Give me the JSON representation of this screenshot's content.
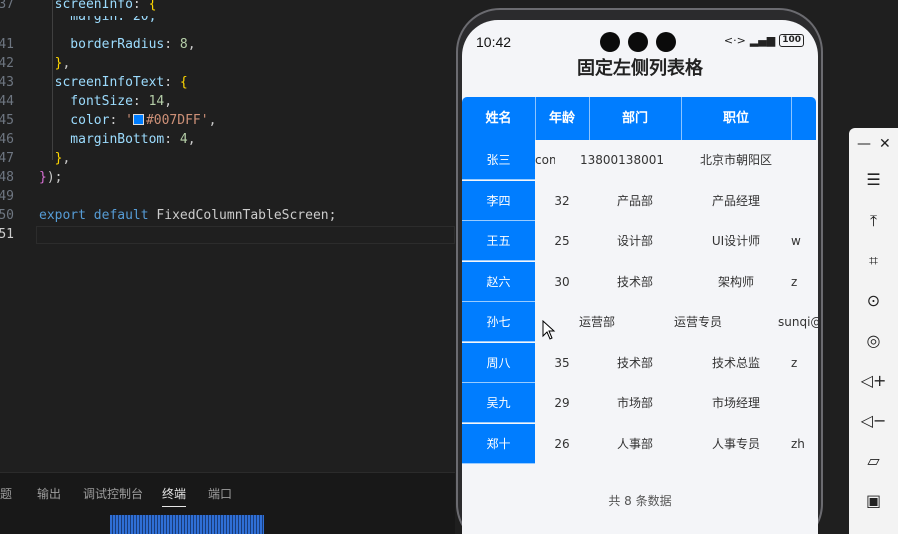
{
  "editor": {
    "lines": [
      {
        "n": "37",
        "parts": [
          [
            "prop",
            "  screenInfo"
          ],
          [
            "t",
            ": "
          ],
          [
            "br",
            "{"
          ]
        ]
      },
      {
        "n": "41",
        "parts": [
          [
            "prop",
            "    borderRadius"
          ],
          [
            "t",
            ": "
          ],
          [
            "num",
            "8"
          ],
          [
            "t",
            ","
          ]
        ]
      },
      {
        "n": "42",
        "parts": [
          [
            "t",
            "  "
          ],
          [
            "br",
            "}"
          ],
          [
            "t",
            ","
          ]
        ]
      },
      {
        "n": "43",
        "parts": [
          [
            "prop",
            "  screenInfoText"
          ],
          [
            "t",
            ": "
          ],
          [
            "br",
            "{"
          ]
        ]
      },
      {
        "n": "44",
        "parts": [
          [
            "prop",
            "    fontSize"
          ],
          [
            "t",
            ": "
          ],
          [
            "num",
            "14"
          ],
          [
            "t",
            ","
          ]
        ]
      },
      {
        "n": "45",
        "parts": [
          [
            "prop",
            "    color"
          ],
          [
            "t",
            ": "
          ],
          [
            "str",
            "'"
          ],
          [
            "swatch",
            ""
          ],
          [
            "str",
            "#007DFF'"
          ],
          [
            "t",
            ","
          ]
        ]
      },
      {
        "n": "46",
        "parts": [
          [
            "prop",
            "    marginBottom"
          ],
          [
            "t",
            ": "
          ],
          [
            "num",
            "4"
          ],
          [
            "t",
            ","
          ]
        ]
      },
      {
        "n": "47",
        "parts": [
          [
            "t",
            "  "
          ],
          [
            "br",
            "}"
          ],
          [
            "t",
            ","
          ]
        ]
      },
      {
        "n": "48",
        "parts": [
          [
            "br2",
            "}"
          ],
          [
            "t",
            ");"
          ]
        ]
      },
      {
        "n": "49",
        "parts": []
      },
      {
        "n": "50",
        "parts": [
          [
            "k",
            "export"
          ],
          [
            "t",
            " "
          ],
          [
            "k",
            "default"
          ],
          [
            "t",
            " "
          ],
          [
            "t",
            "FixedColumnTableScreen;"
          ]
        ]
      },
      {
        "n": "51",
        "parts": []
      }
    ],
    "partial_top": "    margin: 20,"
  },
  "panel": {
    "tabs": [
      "题",
      "输出",
      "调试控制台",
      "终端",
      "端口"
    ],
    "active_tab": "终端"
  },
  "phone": {
    "time": "10:42",
    "battery": "100",
    "title": "固定左侧列表格",
    "headers": [
      "姓名",
      "年龄",
      "部门",
      "职位"
    ],
    "fixed_column": [
      "张三",
      "李四",
      "王五",
      "赵六",
      "孙七",
      "周八",
      "吴九",
      "郑十"
    ],
    "rows": [
      [
        "com",
        "13800138001",
        "北京市朝阳区",
        ""
      ],
      [
        "32",
        "产品部",
        "产品经理",
        ""
      ],
      [
        "25",
        "设计部",
        "UI设计师",
        "w"
      ],
      [
        "30",
        "技术部",
        "架构师",
        "z"
      ],
      [
        "运营部",
        "运营专员",
        "sunqi@",
        ""
      ],
      [
        "35",
        "技术部",
        "技术总监",
        "z"
      ],
      [
        "29",
        "市场部",
        "市场经理",
        ""
      ],
      [
        "26",
        "人事部",
        "人事专员",
        "zh"
      ]
    ],
    "footer": "共 8 条数据",
    "accent_color": "#007DFF"
  },
  "toolbar": {
    "items": [
      "minimize-icon",
      "close-icon",
      "menu-icon",
      "pin-top-icon",
      "crop-icon",
      "rotate-icon",
      "rotate-alt-icon",
      "volume-up-icon",
      "volume-down-icon",
      "rotate-device-icon",
      "screenshot-icon"
    ]
  }
}
